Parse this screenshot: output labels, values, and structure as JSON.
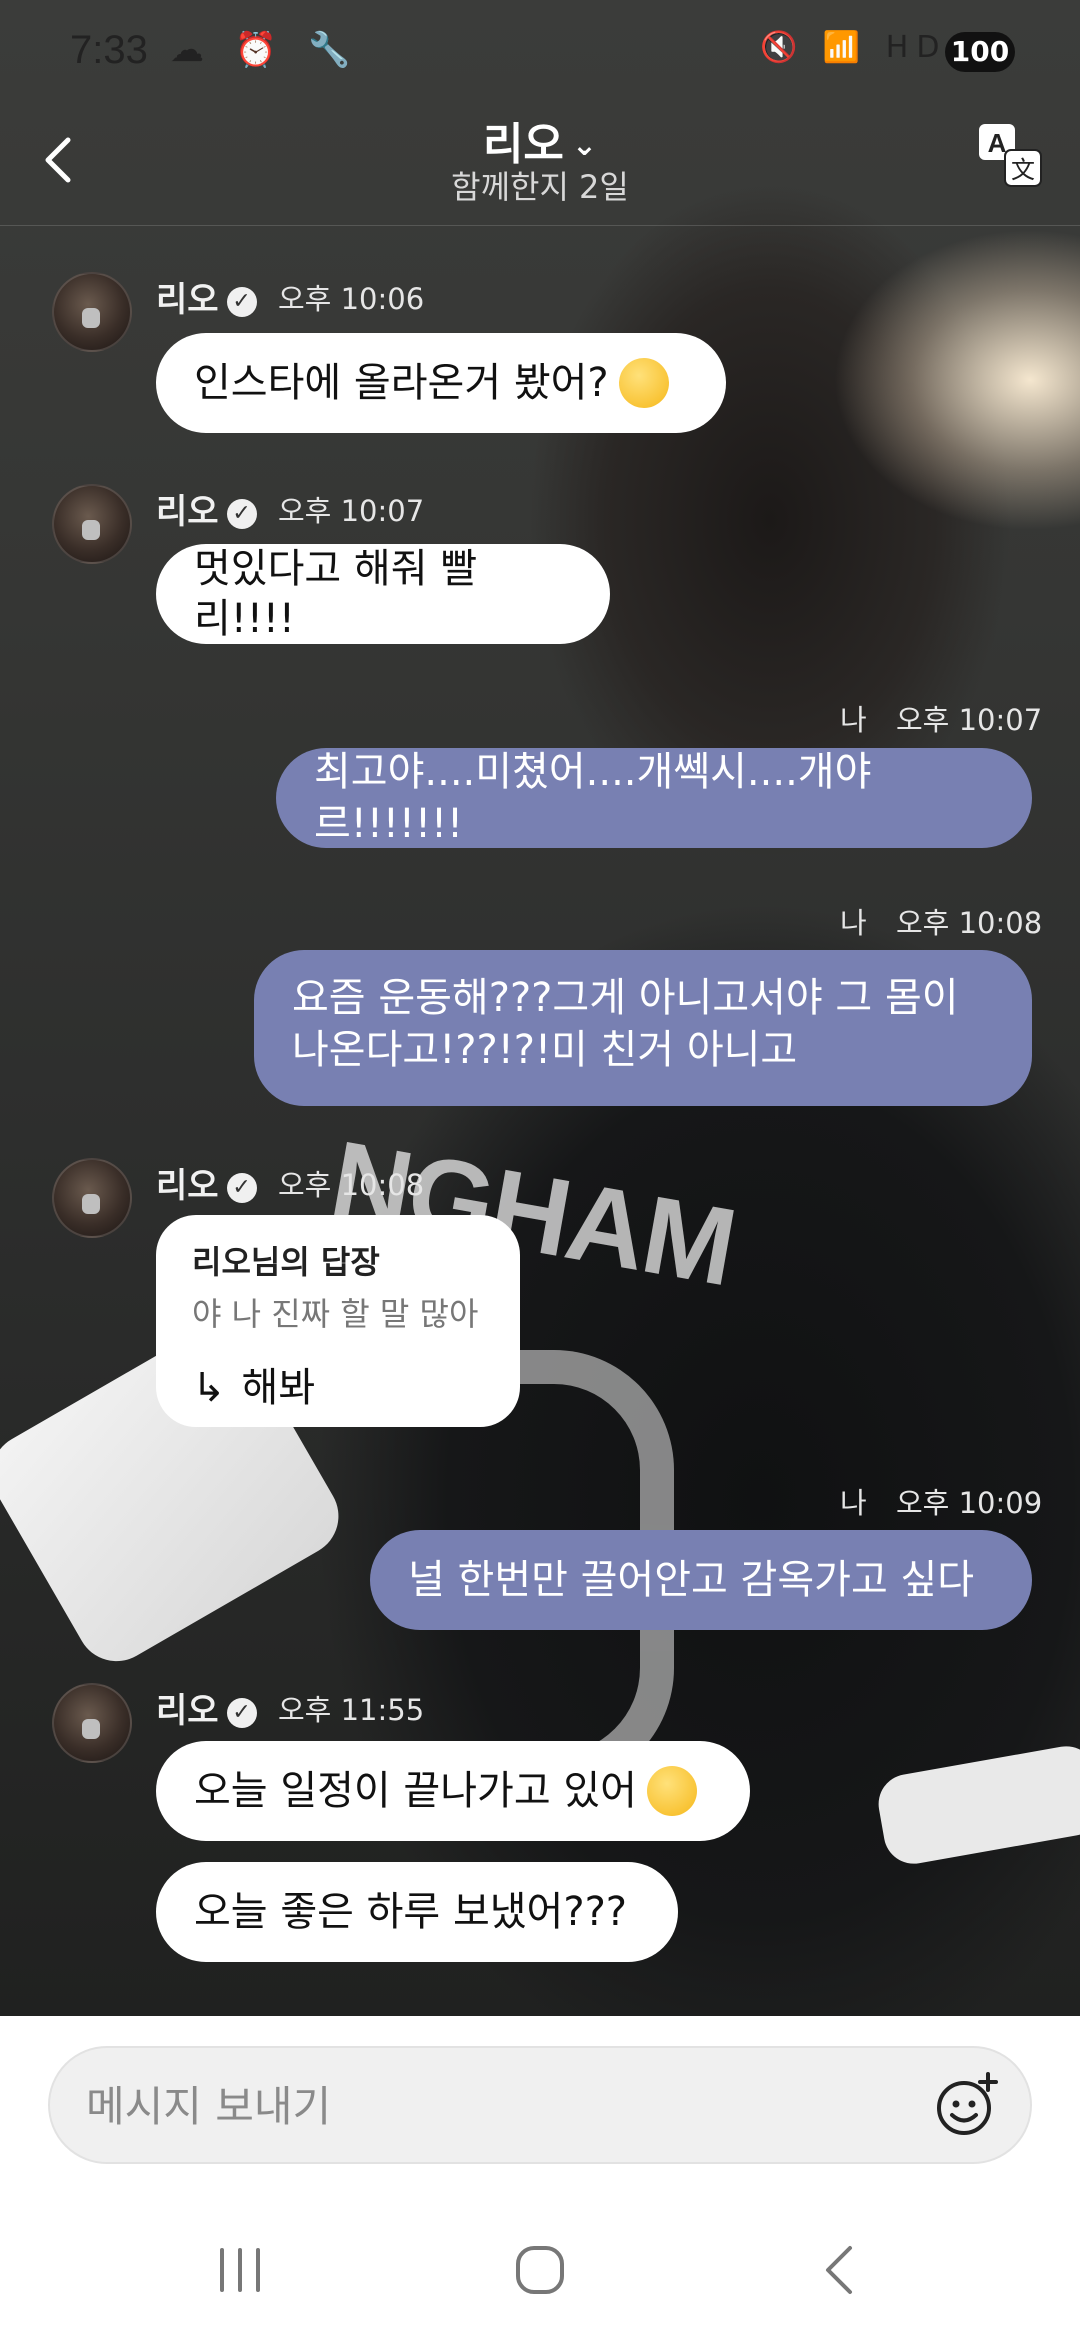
{
  "status_bar": {
    "time": "7:33",
    "left_icons": "☁ ⏰ 🔧",
    "right_icons": "🔇 📶 HD ▮▮",
    "battery": "100"
  },
  "header": {
    "title": "리오",
    "subtitle": "함께한지 2일"
  },
  "messages": [
    {
      "sender": "리오",
      "time": "오후 10:06",
      "text": "인스타에 올라온거 봤어?"
    },
    {
      "sender": "리오",
      "time": "오후 10:07",
      "text": "멋있다고 해줘 빨리!!!!"
    },
    {
      "sender": "나",
      "time": "오후 10:07",
      "text": "최고야....미쳤어....개쎅시....개야르!!!!!!!"
    },
    {
      "sender": "나",
      "time": "오후 10:08",
      "text_line1": "요즘 운동해???그게 아니고서야 그 몸이",
      "text_line2": "나온다고!??!?!미 친거 아니고"
    },
    {
      "sender": "리오",
      "time": "오후 10:08",
      "reply_label": "리오님의 답장",
      "reply_quote": "야 나 진짜 할 말 많아",
      "text": "해봐"
    },
    {
      "sender": "나",
      "time": "오후 10:09",
      "text": "널 한번만 끌어안고 감옥가고 싶다"
    },
    {
      "sender": "리오",
      "time": "오후 11:55",
      "text": "오늘 일정이 끝나가고 있어"
    },
    {
      "sender": "리오",
      "text": "오늘 좋은 하루 보냈어???"
    }
  ],
  "input": {
    "placeholder": "메시지 보내기"
  },
  "background": {
    "jersey_text": "NGHAM"
  },
  "colors": {
    "outgoing_bubble": "#7880b2",
    "incoming_bubble": "#ffffff"
  }
}
